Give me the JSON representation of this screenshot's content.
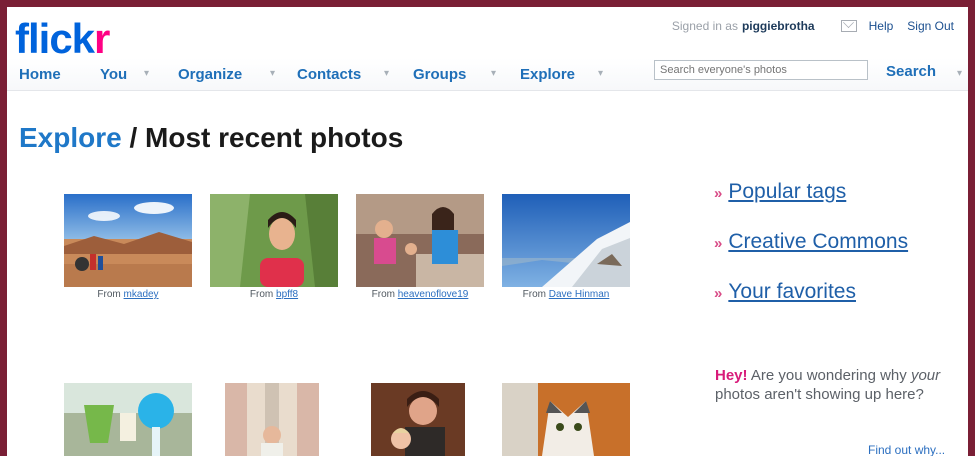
{
  "header": {
    "logo_part1": "flick",
    "logo_part2": "r",
    "signed_in_prefix": "Signed in as",
    "username": "piggiebrotha",
    "help": "Help",
    "sign_out": "Sign Out"
  },
  "nav": {
    "items": [
      "Home",
      "You",
      "Organize",
      "Contacts",
      "Groups",
      "Explore"
    ],
    "search_placeholder": "Search everyone's photos",
    "search_button": "Search"
  },
  "page": {
    "breadcrumb": "Explore",
    "separator": " / ",
    "title": "Most recent photos"
  },
  "photos": [
    {
      "from": "From",
      "user": "mkadey"
    },
    {
      "from": "From",
      "user": "bpff8"
    },
    {
      "from": "From",
      "user": "heavenoflove19"
    },
    {
      "from": "From",
      "user": "Dave Hinman"
    }
  ],
  "sidebar": {
    "bullet": "»",
    "links": [
      "Popular tags",
      "Creative Commons",
      "Your favorites"
    ],
    "hey": "Hey!",
    "msg_a": "Are you wondering why",
    "msg_your": "your",
    "msg_b": "photos aren't showing up here?",
    "find_out": "Find out why..."
  },
  "colors": {
    "frame": "#7a1f35",
    "flickr_blue": "#0063dc",
    "flickr_pink": "#ff0084",
    "link": "#1f5fa8"
  }
}
